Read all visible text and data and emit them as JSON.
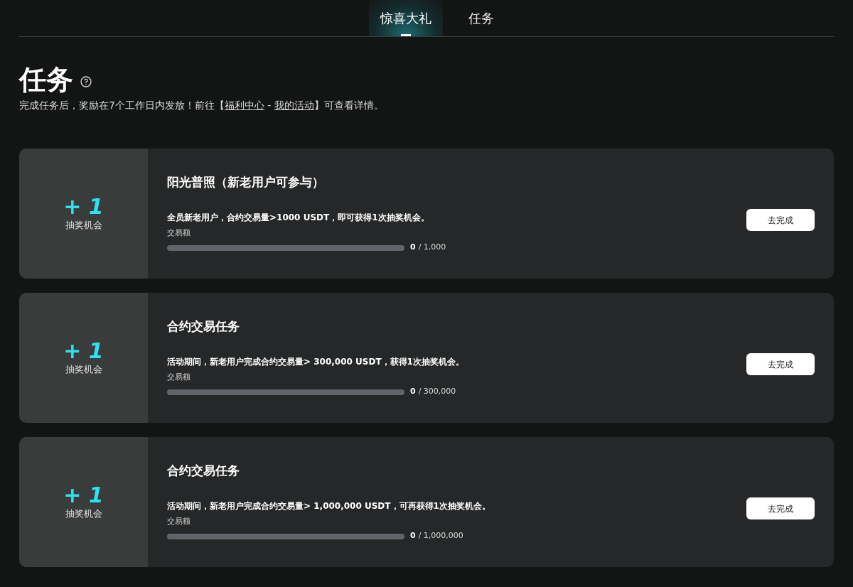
{
  "tabs": [
    {
      "label": "惊喜大礼",
      "selected": true
    },
    {
      "label": "任务",
      "selected": false
    }
  ],
  "header": {
    "title": "任务",
    "description": {
      "before": "完成任务后，奖励在7个工作日内发放！前往【",
      "link_1": "福利中心",
      "separator": " - ",
      "link_2": "我的活动",
      "after": "】可查看详情。"
    }
  },
  "tasks": [
    {
      "reward": "+ 1",
      "reward_label": "抽奖机会",
      "title": "阳光普照（新老用户可参与）",
      "description": "全员新老用户，合约交易量>1000 USDT，即可获得1次抽奖机会。",
      "progress_label": "交易额",
      "level": 0,
      "current": "0",
      "total": "/ 1,000",
      "button": "去完成"
    },
    {
      "reward": "+ 1",
      "reward_label": "抽奖机会",
      "title": "合约交易任务",
      "description": "活动期间，新老用户完成合约交易量> 300,000 USDT，获得1次抽奖机会。",
      "progress_label": "交易额",
      "level": 0,
      "current": "0",
      "total": "/ 300,000",
      "button": "去完成"
    },
    {
      "reward": "+ 1",
      "reward_label": "抽奖机会",
      "title": "合约交易任务",
      "description": "活动期间，新老用户完成合约交易量> 1,000,000 USDT，可再获得1次抽奖机会。",
      "progress_label": "交易额",
      "level": 0,
      "current": "0",
      "total": "/ 1,000,000",
      "button": "去完成"
    }
  ]
}
